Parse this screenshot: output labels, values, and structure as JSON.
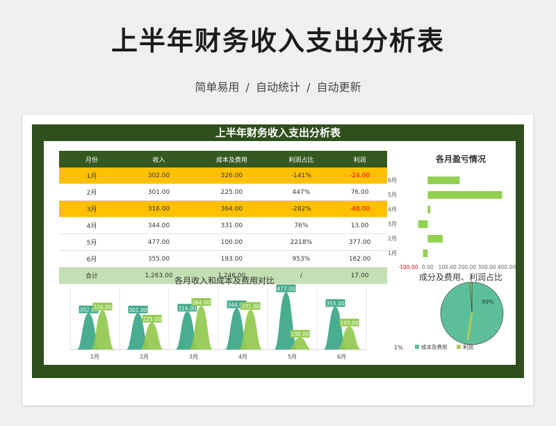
{
  "header": {
    "title": "上半年财务收入支出分析表",
    "subtitle": "简单易用  /  自动统计  /  自动更新"
  },
  "sheet": {
    "title": "上半年财务收入支出分析表",
    "table": {
      "headers": [
        "月份",
        "收入",
        "成本及费用",
        "利润占比",
        "利润"
      ],
      "rows": [
        [
          "1月",
          "302.00",
          "326.00",
          "-141%",
          "-24.00"
        ],
        [
          "2月",
          "301.00",
          "225.00",
          "447%",
          "76.00"
        ],
        [
          "3月",
          "316.00",
          "364.00",
          "-282%",
          "-48.00"
        ],
        [
          "4月",
          "344.00",
          "331.00",
          "76%",
          "13.00"
        ],
        [
          "5月",
          "477.00",
          "100.00",
          "2218%",
          "377.00"
        ],
        [
          "6月",
          "355.00",
          "193.00",
          "953%",
          "162.00"
        ]
      ],
      "total": [
        "合计",
        "1,263.00",
        "1,246.00",
        "/",
        "17.00"
      ]
    }
  },
  "chart_data": [
    {
      "type": "bar",
      "orientation": "horizontal",
      "title": "各月盈亏情况",
      "categories": [
        "1月",
        "2月",
        "3月",
        "4月",
        "5月",
        "6月"
      ],
      "values": [
        -24,
        76,
        -48,
        13,
        377,
        162
      ],
      "xlim": [
        -100,
        400
      ],
      "ticks": [
        "-100.00",
        "0.00",
        "100.00",
        "200.00",
        "300.00",
        "400.00"
      ],
      "color": "#92d050"
    },
    {
      "type": "area",
      "title": "各月收入和成本及费用对比",
      "categories": [
        "1月",
        "2月",
        "3月",
        "4月",
        "5月",
        "6月"
      ],
      "series": [
        {
          "values": [
            302,
            301,
            316,
            344,
            477,
            355
          ],
          "color": "#3fa98a",
          "labels": [
            "302.00",
            "301.00",
            "316.00",
            "344.00",
            "477.00",
            "355.00"
          ]
        },
        {
          "values": [
            326,
            225,
            364,
            331,
            100,
            193
          ],
          "color": "#92c94e",
          "labels": [
            "326.00",
            "225.00",
            "364.00",
            "331.00",
            "100.00",
            "193.00"
          ]
        }
      ],
      "ylim": [
        0,
        520
      ]
    },
    {
      "type": "pie",
      "title": "成分及费用、利润占比",
      "slices": [
        {
          "name": "成本及费用",
          "value": 99,
          "label": "99%",
          "color": "#5dbf9a"
        },
        {
          "name": "利润",
          "value": 1,
          "label": "1%",
          "color": "#b0c85a"
        }
      ]
    }
  ]
}
